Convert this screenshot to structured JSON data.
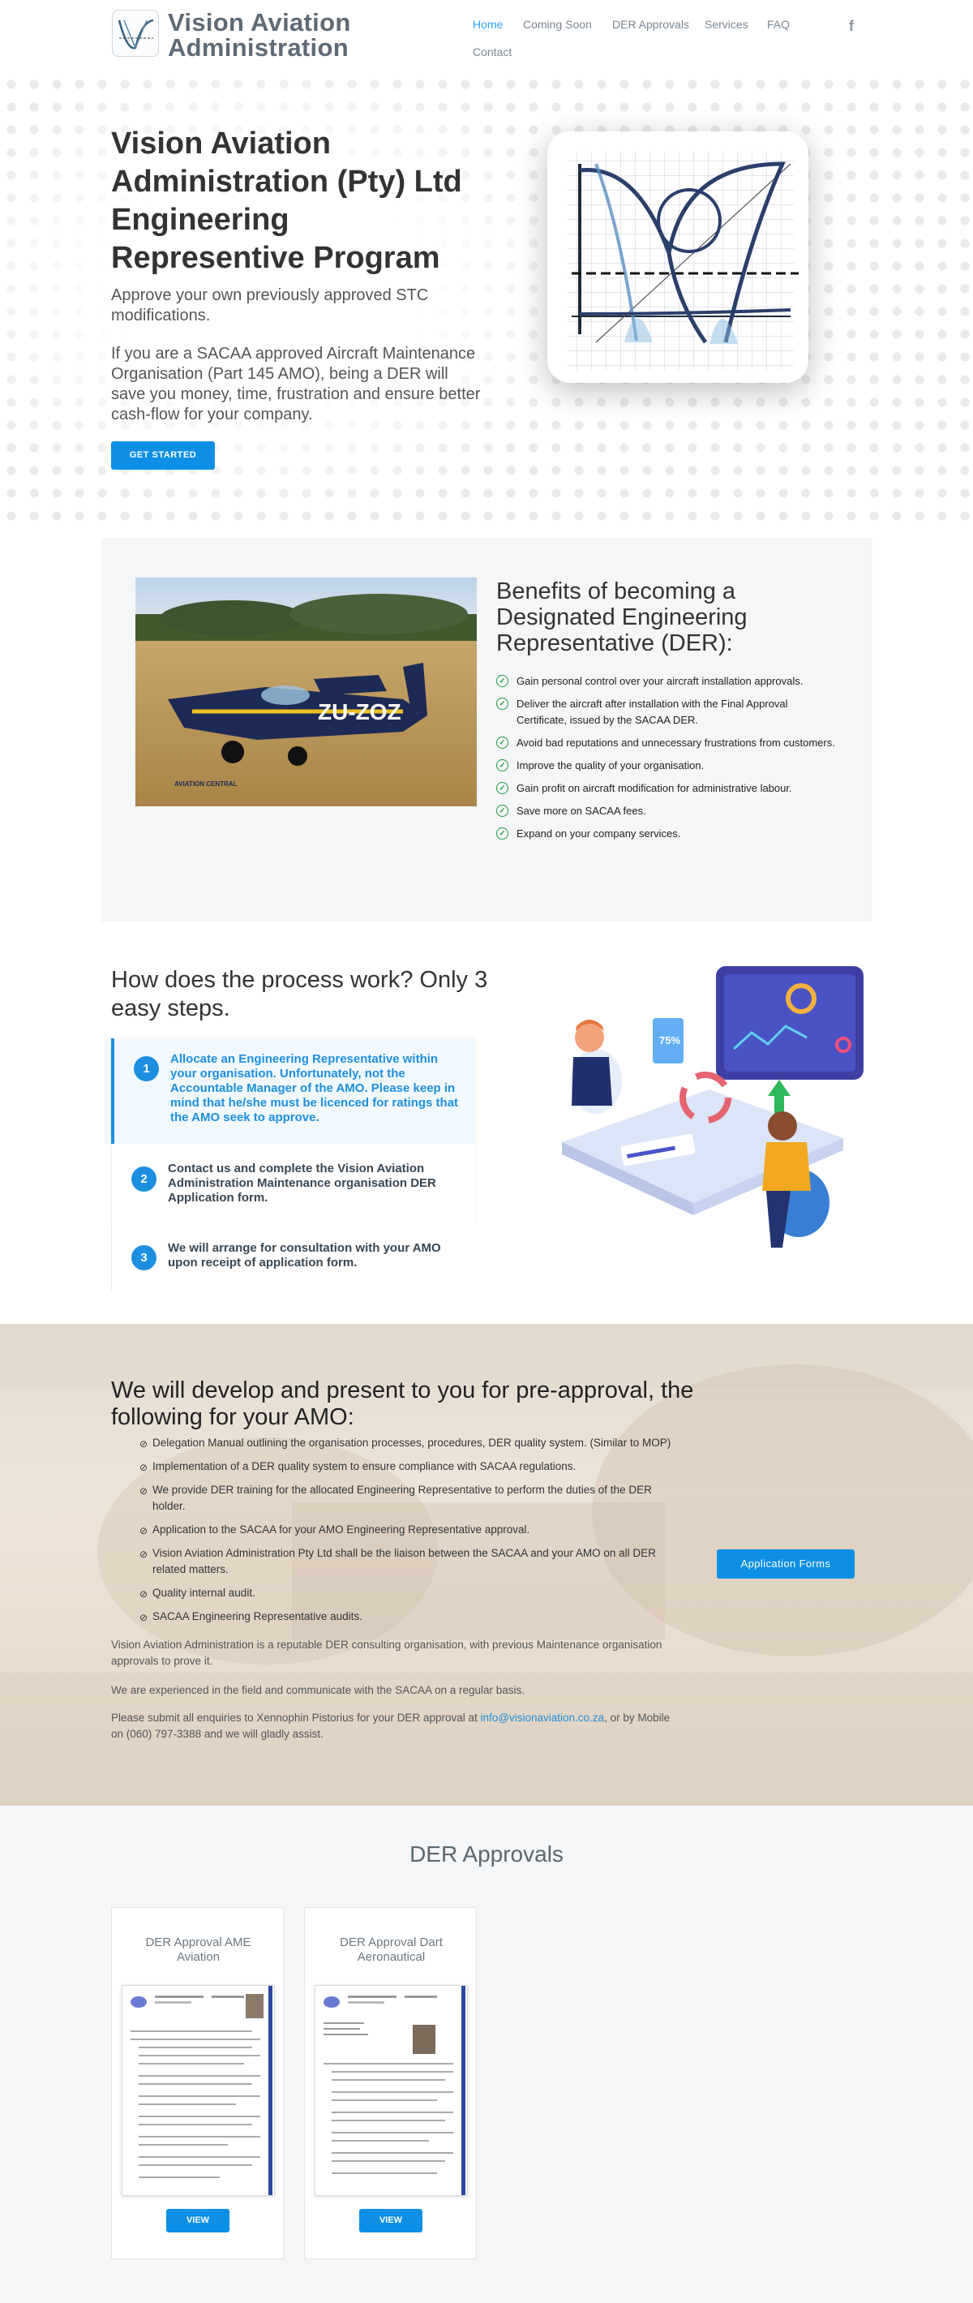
{
  "header": {
    "logo_line1": "Vision Aviation",
    "logo_line2": "Administration",
    "nav": [
      "Home",
      "Coming Soon",
      "DER Approvals",
      "Services",
      "FAQ",
      "Contact"
    ],
    "social_icon": "facebook-icon"
  },
  "hero": {
    "title": "Vision Aviation Administration (Pty) Ltd Engineering Representive Program",
    "subtitle": "Approve your own previously approved STC modifications.",
    "body": "If you are a SACAA approved Aircraft Maintenance Organisation (Part 145 AMO), being a DER will save you money, time, frustration and ensure better cash-flow for your company.",
    "cta": "GET STARTED"
  },
  "benefits": {
    "title": "Benefits of becoming a Designated Engineering Representative (DER):",
    "image_text": "AVIATION CENTRAL",
    "items": [
      "Gain personal control over your aircraft installation approvals.",
      "Deliver the aircraft after installation with the Final Approval Certificate, issued by the SACAA DER.",
      "Avoid bad reputations and unnecessary frustrations from customers.",
      "Improve the quality of your organisation.",
      "Gain profit on aircraft modification for administrative labour.",
      "Save more on SACAA fees.",
      "Expand on your company services."
    ]
  },
  "process": {
    "title": "How does the process work? Only 3 easy steps.",
    "steps": [
      {
        "num": "1",
        "text": "Allocate an Engineering Representative within your organisation. Unfortunately, not the Accountable Manager of the AMO. Please keep in mind that he/she must be licenced for ratings that the AMO seek to approve."
      },
      {
        "num": "2",
        "text": "Contact us and complete the Vision Aviation Administration Maintenance organisation DER Application form."
      },
      {
        "num": "3",
        "text": "We will arrange for consultation with your AMO upon receipt of application form."
      }
    ],
    "illus_badge": "75%"
  },
  "develop": {
    "title": "We will develop and present to you for pre-approval, the following for your AMO:",
    "items": [
      "Delegation Manual outlining the organisation processes, procedures, DER quality system. (Similar to MOP)",
      "Implementation of a DER quality system to ensure compliance with SACAA regulations.",
      "We provide DER training for the allocated Engineering Representative to perform the duties of the DER holder.",
      "Application to the SACAA for your AMO Engineering Representative approval.",
      "Vision Aviation Administration Pty Ltd shall be the liaison between the SACAA and your AMO on all DER related matters.",
      "Quality internal audit.",
      "SACAA Engineering Representative audits."
    ],
    "button": "Application Forms",
    "para1": "Vision Aviation Administration is a reputable DER consulting organisation, with previous Maintenance organisation approvals to prove it.",
    "para2": "We are experienced in the field and communicate with the SACAA on a regular basis.",
    "para3_before": "Please submit all enquiries to Xennophin Pistorius for your DER approval at",
    "email": "info@visionaviation.co.za",
    "para3_after": ", or by Mobile on (060) 797-3388 and we will gladly assist."
  },
  "approvals": {
    "title": "DER Approvals",
    "cards": [
      {
        "title": "DER Approval AME Aviation",
        "button": "VIEW"
      },
      {
        "title": "DER Approval Dart Aeronautical",
        "button": "VIEW"
      }
    ]
  }
}
